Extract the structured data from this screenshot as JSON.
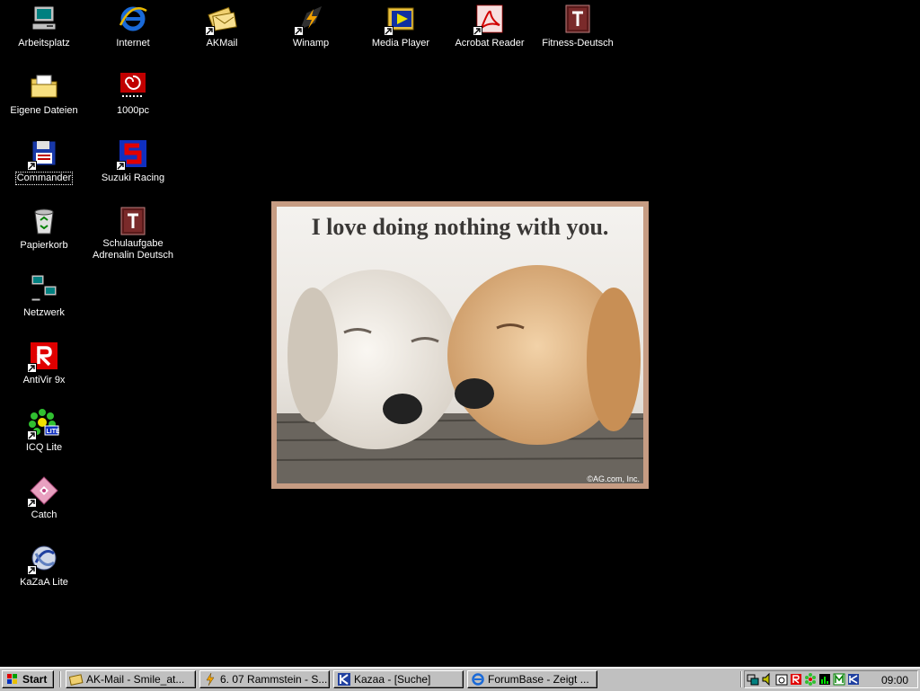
{
  "desktop": {
    "icons": [
      {
        "label": "Arbeitsplatz",
        "icon": "my-computer-icon"
      },
      {
        "label": "Eigene Dateien",
        "icon": "documents-folder-icon"
      },
      {
        "label": "Commander",
        "icon": "commander-icon"
      },
      {
        "label": "Papierkorb",
        "icon": "recycle-bin-icon"
      },
      {
        "label": "Netzwerk",
        "icon": "network-icon"
      },
      {
        "label": "AntiVir 9x",
        "icon": "antivir-icon"
      },
      {
        "label": "ICQ Lite",
        "icon": "icq-icon"
      },
      {
        "label": "Catch",
        "icon": "catch-icon"
      },
      {
        "label": "KaZaA Lite",
        "icon": "kazaa-icon"
      },
      {
        "label": "Internet",
        "icon": "internet-explorer-icon"
      },
      {
        "label": "1000pc",
        "icon": "1000pc-icon"
      },
      {
        "label": "Suzuki Racing",
        "icon": "suzuki-icon"
      },
      {
        "label": "Schulaufgabe Adrenalin Deutsch",
        "icon": "schulaufgabe-icon"
      },
      {
        "label": "AKMail",
        "icon": "akmail-icon"
      },
      {
        "label": "Winamp",
        "icon": "winamp-icon"
      },
      {
        "label": "Media Player",
        "icon": "media-player-icon"
      },
      {
        "label": "Acrobat Reader",
        "icon": "acrobat-icon"
      },
      {
        "label": "Fitness-Deutsch",
        "icon": "fitness-deutsch-icon"
      }
    ],
    "wallpaper": {
      "caption": "I love doing nothing with you.",
      "credit": "©AG.com, Inc."
    }
  },
  "taskbar": {
    "start_label": "Start",
    "buttons": [
      {
        "label": "AK-Mail - Smile_at...",
        "icon": "akmail-icon"
      },
      {
        "label": "6. 07 Rammstein - S...",
        "icon": "winamp-icon"
      },
      {
        "label": "Kazaa - [Suche]",
        "icon": "kazaa-icon"
      },
      {
        "label": "ForumBase - Zeigt ...",
        "icon": "internet-explorer-icon"
      }
    ],
    "tray_icons": [
      "network-tray-icon",
      "volume-icon",
      "task-scheduler-icon",
      "antivir-tray-icon",
      "icq-tray-icon",
      "resource-meter-icon",
      "m-tray-icon",
      "kazaa-tray-icon"
    ],
    "clock": "09:00"
  }
}
